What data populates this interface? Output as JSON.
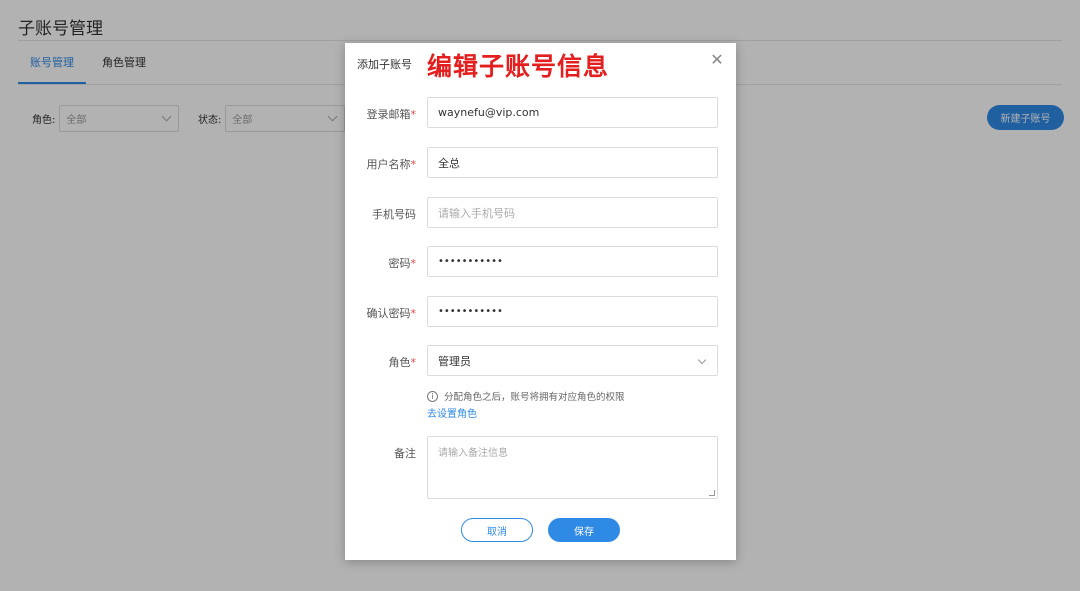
{
  "page": {
    "title": "子账号管理",
    "tabs": [
      {
        "label": "账号管理",
        "active": true
      },
      {
        "label": "角色管理",
        "active": false
      }
    ],
    "filters": {
      "role_label": "角色:",
      "role_value": "全部",
      "status_label": "状态:",
      "status_value": "全部"
    },
    "new_button": "新建子账号"
  },
  "dialog": {
    "title": "添加子账号",
    "overlay_title": "编辑子账号信息",
    "close_icon": "close-icon",
    "fields": {
      "email": {
        "label": "登录邮箱",
        "required": "*",
        "value": "waynefu@vip.com"
      },
      "username": {
        "label": "用户名称",
        "required": "*",
        "value": "全总"
      },
      "phone": {
        "label": "手机号码",
        "placeholder": "请输入手机号码"
      },
      "password": {
        "label": "密码",
        "required": "*",
        "value": "•••••••••••"
      },
      "confirm_password": {
        "label": "确认密码",
        "required": "*",
        "value": "•••••••••••"
      },
      "role": {
        "label": "角色",
        "required": "*",
        "value": "管理员"
      },
      "note": {
        "label": "备注",
        "placeholder": "请输入备注信息"
      }
    },
    "role_hint": "分配角色之后，账号将拥有对应角色的权限",
    "role_link": "去设置角色",
    "cancel_label": "取消",
    "save_label": "保存"
  },
  "colors": {
    "accent": "#2f8ae5",
    "overlay_title": "#e41f1f",
    "required": "#e64545"
  }
}
